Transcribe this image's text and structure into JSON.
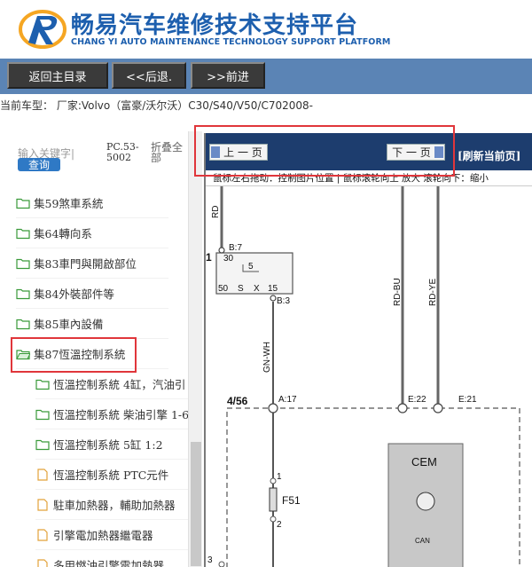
{
  "header": {
    "title_cn": "畅易汽车维修技术支持平台",
    "title_en": "CHANG YI AUTO MAINTENANCE TECHNOLOGY SUPPORT PLATFORM"
  },
  "nav": {
    "back_main": "返回主目录",
    "back": "<<后退.",
    "forward": ">>前进"
  },
  "car_model": "当前车型： 厂家:Volvo（富豪/沃尔沃）C30/S40/V50/C702008-",
  "sidebar": {
    "search_placeholder": "输入关键字|",
    "search_button": "查询",
    "pc_code": "PC.53-5002",
    "fold_all": "折叠全部",
    "items": [
      {
        "label": "集59煞車系統",
        "type": "folder"
      },
      {
        "label": "集64轉向系",
        "type": "folder"
      },
      {
        "label": "集83車門與開啟部位",
        "type": "folder"
      },
      {
        "label": "集84外裝部件等",
        "type": "folder"
      },
      {
        "label": "集85車內設備",
        "type": "folder"
      },
      {
        "label": "集87恆溫控制系統",
        "type": "folder-open"
      },
      {
        "label": "恆溫控制系統 4缸，汽油引",
        "type": "folder"
      },
      {
        "label": "恆溫控制系統 柴油引擎 1-6",
        "type": "folder"
      },
      {
        "label": "恆溫控制系統 5缸 1:2",
        "type": "folder"
      },
      {
        "label": "恆溫控制系統 PTC元件",
        "type": "doc"
      },
      {
        "label": "駐車加熱器，輔助加熱器",
        "type": "doc"
      },
      {
        "label": "引擎電加熱器繼電器",
        "type": "doc"
      },
      {
        "label": "多用燃油引擎電加熱器",
        "type": "doc"
      }
    ]
  },
  "diagram": {
    "prev_page": "上 一 页",
    "next_page": "下 一 页",
    "refresh": "[刷新当前页]",
    "hint": "鼠标左右拖动：控制图片位置 | 鼠标滚轮向上 放大  滚轮向下：缩小",
    "labels": {
      "rd": "RD",
      "b7": "B:7",
      "one": "1",
      "p30": "30",
      "p5": "5",
      "p50": "50",
      "ps": "S",
      "px": "X",
      "p15": "15",
      "b3": "B:3",
      "rdbu": "RD-BU",
      "rdye": "RD-YE",
      "gnwh": "GN-WH",
      "ref": "4/56",
      "a17": "A:17",
      "e22": "E:22",
      "e21": "E:21",
      "cem": "CEM",
      "can": "CAN",
      "f51": "F51",
      "f51_1": "1",
      "f51_2": "2",
      "edge3": "3"
    }
  },
  "colors": {
    "brand": "#1d5fae",
    "navbar": "#5b84b5",
    "toolbar": "#1d3d6e",
    "highlight": "#e0363b",
    "search_button": "#2f79c5"
  }
}
